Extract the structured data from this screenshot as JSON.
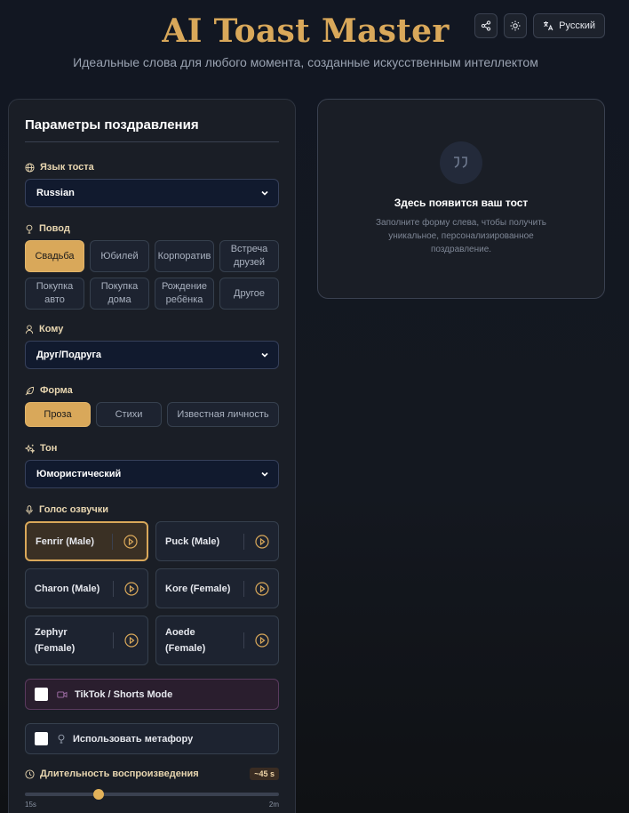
{
  "header": {
    "title": "AI Toast Master",
    "subtitle": "Идеальные слова для любого момента, созданные искусственным интеллектом",
    "lang_button": "Русский",
    "share_icon": "share-icon",
    "theme_icon": "sun-icon",
    "lang_icon": "translate-icon"
  },
  "form": {
    "title": "Параметры поздравления",
    "toast_language": {
      "label": "Язык тоста",
      "value": "Russian"
    },
    "occasion": {
      "label": "Повод",
      "options": [
        "Свадьба",
        "Юбилей",
        "Корпоратив",
        "Встреча друзей",
        "Покупка авто",
        "Покупка дома",
        "Рождение ребёнка",
        "Другое"
      ],
      "selected": "Свадьба"
    },
    "recipient": {
      "label": "Кому",
      "value": "Друг/Подруга"
    },
    "form_type": {
      "label": "Форма",
      "options": [
        "Проза",
        "Стихи",
        "Известная личность"
      ],
      "selected": "Проза"
    },
    "tone": {
      "label": "Тон",
      "value": "Юмористический"
    },
    "voice": {
      "label": "Голос озвучки",
      "options": [
        "Fenrir (Male)",
        "Puck (Male)",
        "Charon (Male)",
        "Kore (Female)",
        "Zephyr (Female)",
        "Aoede (Female)"
      ],
      "selected": "Fenrir (Male)"
    },
    "tiktok_mode": {
      "label": "TikTok / Shorts Mode",
      "checked": false
    },
    "metaphor": {
      "label": "Использовать метафору",
      "checked": false
    },
    "duration": {
      "label": "Длительность воспроизведения",
      "badge": "~45 s",
      "min_label": "15s",
      "max_label": "2m",
      "level_percent": 29
    }
  },
  "output": {
    "title": "Здесь появится ваш тост",
    "text": "Заполните форму слева, чтобы получить уникальное, персонализированное поздравление."
  },
  "colors": {
    "accent": "#d9a85a",
    "panel": "#1a1e26",
    "select_bg": "#111a2e"
  }
}
